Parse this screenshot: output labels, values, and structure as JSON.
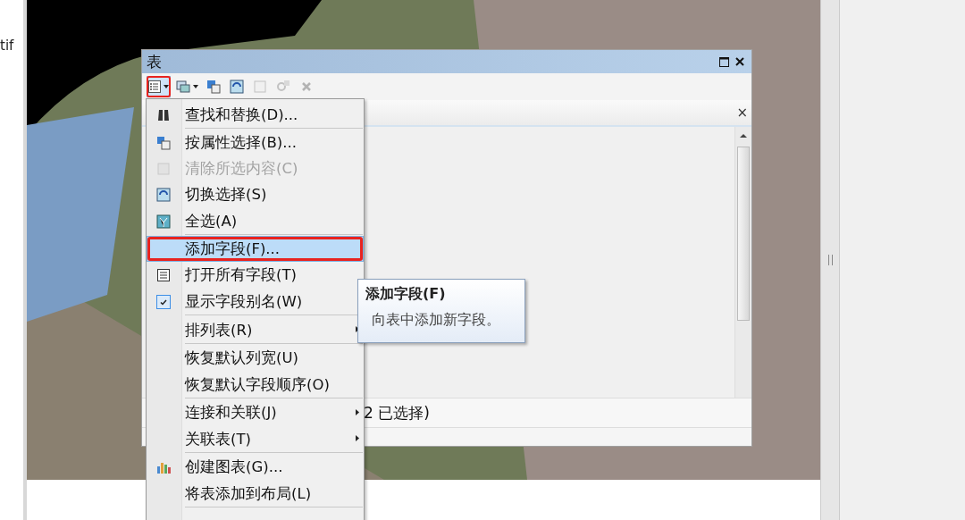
{
  "left_panel": {
    "label": "tif"
  },
  "table_window": {
    "title": "表",
    "tab_close": "×",
    "status": "2 已选择)"
  },
  "toolbar": [
    {
      "kind": "options",
      "selected": true,
      "disabled": false
    },
    {
      "kind": "relate",
      "selected": false,
      "disabled": false
    },
    {
      "kind": "select-by-attr",
      "selected": false,
      "disabled": false
    },
    {
      "kind": "switch",
      "selected": false,
      "disabled": false
    },
    {
      "kind": "clear",
      "selected": false,
      "disabled": true
    },
    {
      "kind": "zoom",
      "selected": false,
      "disabled": true
    },
    {
      "kind": "delete",
      "selected": false,
      "disabled": true
    }
  ],
  "menu": [
    {
      "label": "查找和替换(D)...",
      "disabled": false,
      "selected": false,
      "checked": false,
      "submenu": false,
      "separator_after": true
    },
    {
      "label": "按属性选择(B)...",
      "disabled": false,
      "selected": false,
      "checked": false,
      "submenu": false,
      "separator_after": false
    },
    {
      "label": "清除所选内容(C)",
      "disabled": true,
      "selected": false,
      "checked": false,
      "submenu": false,
      "separator_after": false
    },
    {
      "label": "切换选择(S)",
      "disabled": false,
      "selected": false,
      "checked": false,
      "submenu": false,
      "separator_after": false
    },
    {
      "label": "全选(A)",
      "disabled": false,
      "selected": false,
      "checked": false,
      "submenu": false,
      "separator_after": true
    },
    {
      "label": "添加字段(F)...",
      "disabled": false,
      "selected": true,
      "checked": false,
      "submenu": false,
      "separator_after": false
    },
    {
      "label": "打开所有字段(T)",
      "disabled": false,
      "selected": false,
      "checked": false,
      "submenu": false,
      "separator_after": false
    },
    {
      "label": "显示字段别名(W)",
      "disabled": false,
      "selected": false,
      "checked": true,
      "submenu": false,
      "separator_after": true
    },
    {
      "label": "排列表(R)",
      "disabled": false,
      "selected": false,
      "checked": false,
      "submenu": true,
      "separator_after": true
    },
    {
      "label": "恢复默认列宽(U)",
      "disabled": false,
      "selected": false,
      "checked": false,
      "submenu": false,
      "separator_after": false
    },
    {
      "label": "恢复默认字段顺序(O)",
      "disabled": false,
      "selected": false,
      "checked": false,
      "submenu": false,
      "separator_after": true
    },
    {
      "label": "连接和关联(J)",
      "disabled": false,
      "selected": false,
      "checked": false,
      "submenu": true,
      "separator_after": false
    },
    {
      "label": "关联表(T)",
      "disabled": false,
      "selected": false,
      "checked": false,
      "submenu": true,
      "separator_after": true
    },
    {
      "label": "创建图表(G)...",
      "disabled": false,
      "selected": false,
      "checked": false,
      "submenu": false,
      "separator_after": false
    },
    {
      "label": "将表添加到布局(L)",
      "disabled": false,
      "selected": false,
      "checked": false,
      "submenu": false,
      "separator_after": true
    }
  ],
  "tooltip": {
    "title": "添加字段(F)",
    "text": "向表中添加新字段。"
  }
}
